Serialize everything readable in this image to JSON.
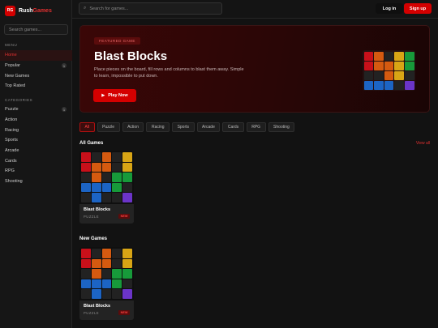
{
  "brand": {
    "logo_mark": "RG",
    "name_first": "Rush",
    "name_second": "Games"
  },
  "sidebar": {
    "search_placeholder": "Search games...",
    "menu_label": "MENU",
    "menu_items": [
      {
        "label": "Home",
        "active": true,
        "badge": ""
      },
      {
        "label": "Popular",
        "active": false,
        "badge": "1"
      },
      {
        "label": "New Games",
        "active": false,
        "badge": ""
      },
      {
        "label": "Top Rated",
        "active": false,
        "badge": ""
      }
    ],
    "categories_label": "CATEGORIES",
    "category_items": [
      {
        "label": "Puzzle",
        "badge": "1"
      },
      {
        "label": "Action",
        "badge": ""
      },
      {
        "label": "Racing",
        "badge": ""
      },
      {
        "label": "Sports",
        "badge": ""
      },
      {
        "label": "Arcade",
        "badge": ""
      },
      {
        "label": "Cards",
        "badge": ""
      },
      {
        "label": "RPG",
        "badge": ""
      },
      {
        "label": "Shooting",
        "badge": ""
      }
    ]
  },
  "header": {
    "search_placeholder": "Search for games...",
    "search_icon": "search-icon",
    "login_label": "Log in",
    "signup_label": "Sign up"
  },
  "hero": {
    "badge": "FEATURED GAME",
    "title": "Blast Blocks",
    "description": "Place pieces on the board, fill rows and columns to blast them away. Simple to learn, impossible to put down.",
    "play_icon": "play-icon",
    "play_label": "Play Now",
    "grid": [
      [
        "red",
        "orange",
        "empty",
        "yellow",
        "green"
      ],
      [
        "red",
        "orange",
        "orange",
        "yellow",
        "green"
      ],
      [
        "empty",
        "empty",
        "orange",
        "yellow",
        "empty"
      ],
      [
        "blue",
        "blue",
        "blue",
        "empty",
        "purple"
      ]
    ]
  },
  "filters": {
    "chips": [
      "All",
      "Puzzle",
      "Action",
      "Racing",
      "Sports",
      "Arcade",
      "Cards",
      "RPG",
      "Shooting"
    ],
    "active_index": 0
  },
  "sections": {
    "all_games": {
      "title": "All Games",
      "view_all": "View all"
    },
    "new_games": {
      "title": "New Games"
    }
  },
  "card": {
    "name": "Blast Blocks",
    "category": "PUZZLE",
    "badge": "NEW",
    "grid": [
      [
        "red",
        "empty",
        "orange",
        "empty",
        "yellow"
      ],
      [
        "red",
        "orange",
        "orange",
        "empty",
        "yellow"
      ],
      [
        "empty",
        "orange",
        "empty",
        "green",
        "green"
      ],
      [
        "blue",
        "blue",
        "blue",
        "green",
        "empty"
      ],
      [
        "empty",
        "blue",
        "empty",
        "empty",
        "purple"
      ]
    ]
  },
  "colors": {
    "accent": "#d40000",
    "red": "#c8101a",
    "orange": "#d55a10",
    "yellow": "#d8a515",
    "green": "#179a3a",
    "blue": "#1c64c4",
    "purple": "#6b34c8"
  }
}
